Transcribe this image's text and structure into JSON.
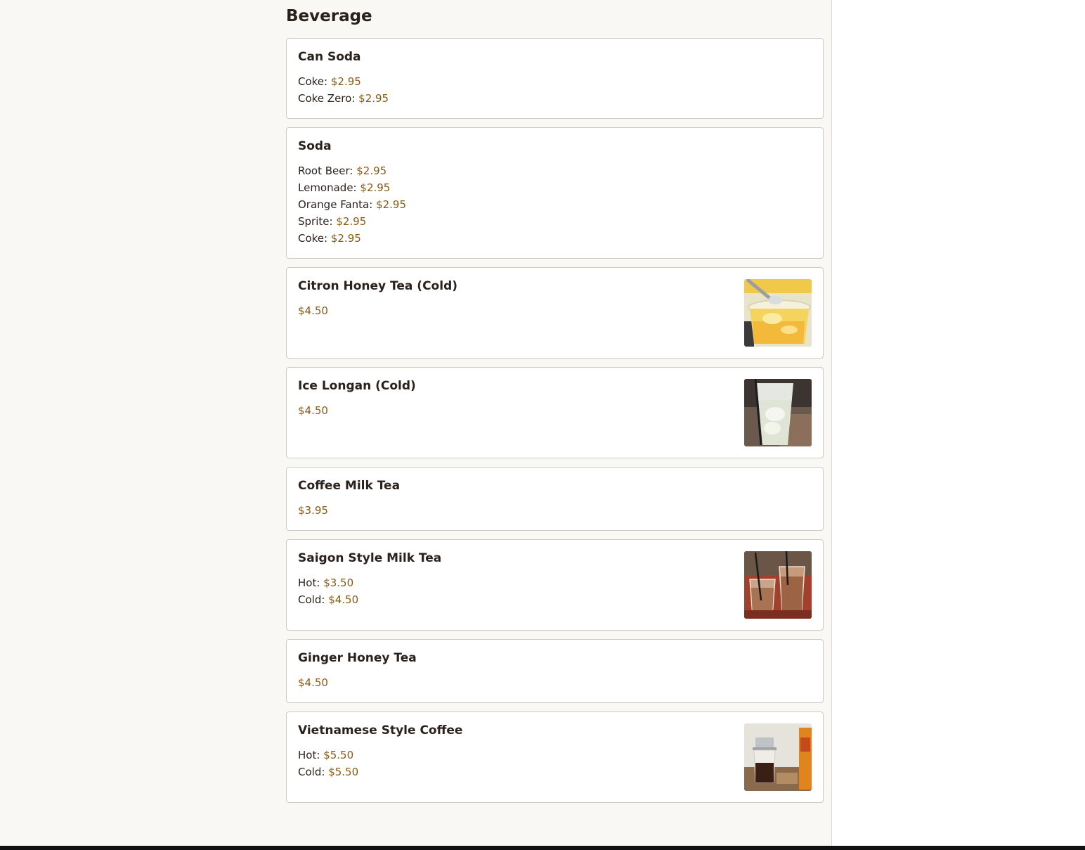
{
  "section": {
    "title": "Beverage"
  },
  "items": [
    {
      "title": "Can Soda",
      "lines": [
        {
          "label": "Coke:",
          "price": "$2.95"
        },
        {
          "label": "Coke Zero:",
          "price": "$2.95"
        }
      ]
    },
    {
      "title": "Soda",
      "lines": [
        {
          "label": "Root Beer:",
          "price": "$2.95"
        },
        {
          "label": "Lemonade:",
          "price": "$2.95"
        },
        {
          "label": "Orange Fanta:",
          "price": "$2.95"
        },
        {
          "label": "Sprite:",
          "price": "$2.95"
        },
        {
          "label": "Coke:",
          "price": "$2.95"
        }
      ]
    },
    {
      "title": "Citron Honey Tea (Cold)",
      "lines": [
        {
          "label": "",
          "price": "$4.50"
        }
      ],
      "image": "citron-honey-tea-photo"
    },
    {
      "title": "Ice Longan (Cold)",
      "lines": [
        {
          "label": "",
          "price": "$4.50"
        }
      ],
      "image": "ice-longan-photo"
    },
    {
      "title": "Coffee Milk Tea",
      "lines": [
        {
          "label": "",
          "price": "$3.95"
        }
      ]
    },
    {
      "title": "Saigon Style Milk Tea",
      "lines": [
        {
          "label": "Hot:",
          "price": "$3.50"
        },
        {
          "label": "Cold:",
          "price": "$4.50"
        }
      ],
      "image": "saigon-milk-tea-photo"
    },
    {
      "title": "Ginger Honey Tea",
      "lines": [
        {
          "label": "",
          "price": "$4.50"
        }
      ]
    },
    {
      "title": "Vietnamese Style Coffee",
      "lines": [
        {
          "label": "Hot:",
          "price": "$5.50"
        },
        {
          "label": "Cold:",
          "price": "$5.50"
        }
      ],
      "image": "vietnamese-coffee-photo"
    }
  ],
  "colors": {
    "price": "#8a5a14",
    "text": "#2b211c",
    "page_background": "#faf8f5",
    "card_border": "#cfcac4"
  }
}
